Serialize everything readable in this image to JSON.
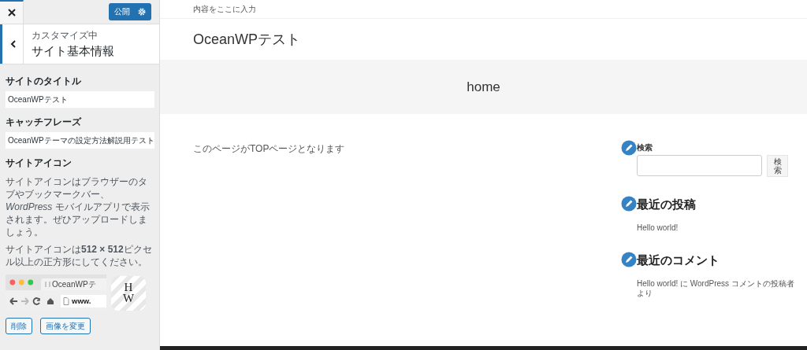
{
  "customizer": {
    "publish": "公開",
    "breadcrumb": "カスタマイズ中",
    "section_title": "サイト基本情報",
    "fields": [
      {
        "label": "サイトのタイトル",
        "value": "OceanWPテスト"
      },
      {
        "label": "キャッチフレーズ",
        "value": "OceanWPテーマの設定方法解説用テスト"
      }
    ],
    "site_icon": {
      "label": "サイトアイコン",
      "descriptions": [
        "サイトアイコンはブラウザーのタブやブックマークバー、*WordPress* モバイルアプリで表示されます。ぜひアップロードしましょう。",
        "サイトアイコンは**512 × 512**ピクセル以上の正方形にしてください。"
      ],
      "preview_tab": "OceanWPテ",
      "preview_address": "www.",
      "icon_letters": "HW",
      "buttons": [
        "削除",
        "画像を変更"
      ]
    }
  },
  "preview": {
    "tagline": "内容をここに入力",
    "site_title": "OceanWPテスト",
    "page_title": "home",
    "body_text": "このページがTOPページとなります",
    "search": {
      "label": "検索",
      "button": "検索"
    },
    "widgets": [
      {
        "title": "最近の投稿",
        "text": "Hello world!"
      },
      {
        "title": "最近のコメント",
        "text": "Hello world! に WordPress コメントの投稿者より"
      }
    ]
  }
}
